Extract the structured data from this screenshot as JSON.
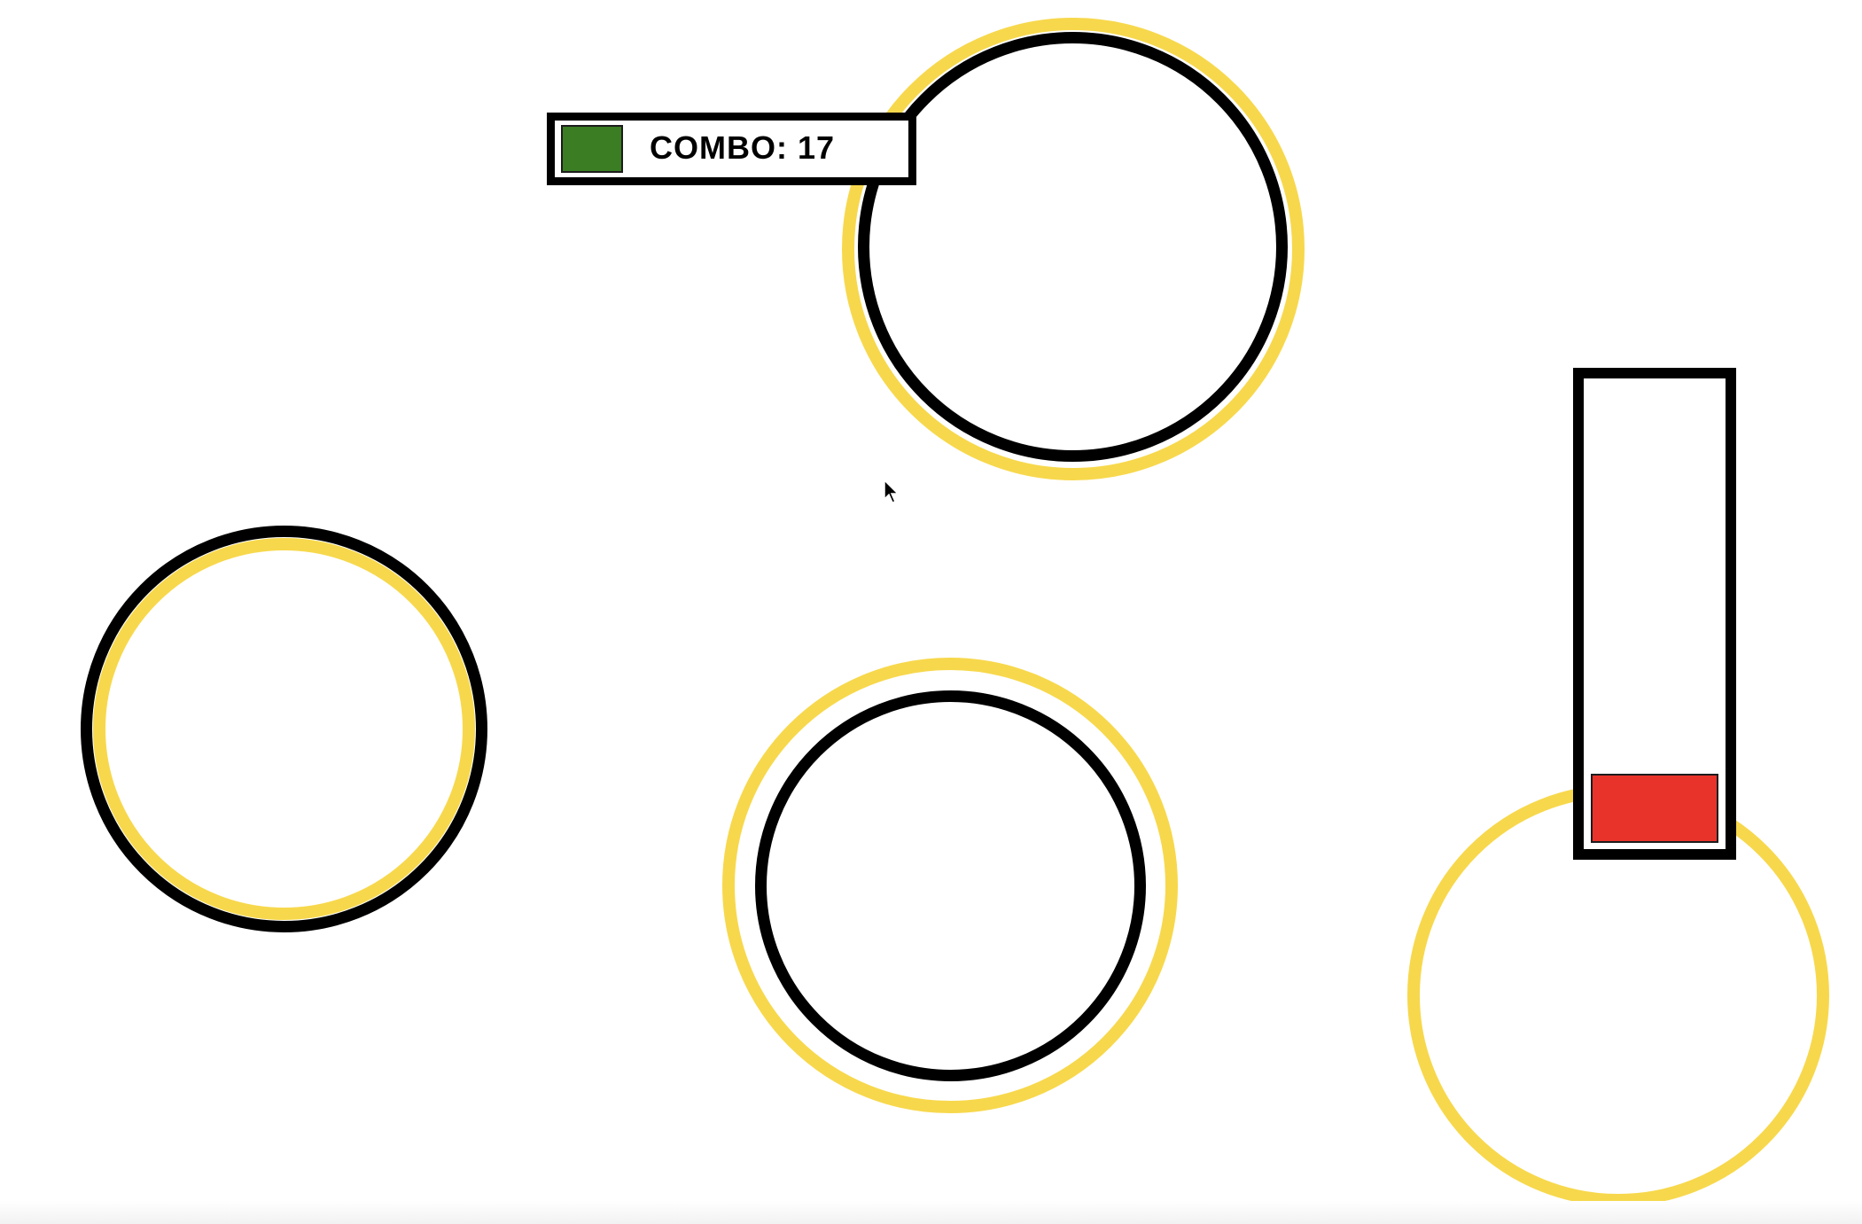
{
  "combo": {
    "label": "COMBO: 17",
    "swatch_color": "#3a7d22"
  },
  "health": {
    "fill_color": "#e8332a",
    "level": 0.15
  },
  "ring_colors": {
    "target": "#f7d84c",
    "approach": "#000000"
  },
  "cursor_icon": "mouse-pointer-icon"
}
